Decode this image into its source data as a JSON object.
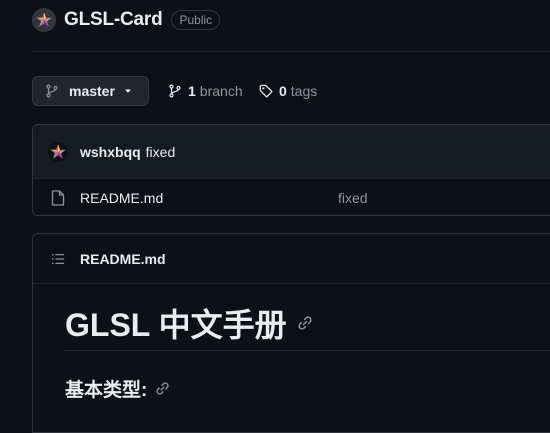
{
  "repo": {
    "name": "GLSL-Card",
    "visibility": "Public"
  },
  "branch_bar": {
    "current_branch": "master",
    "branches_count": "1",
    "branches_label": "branch",
    "tags_count": "0",
    "tags_label": "tags"
  },
  "latest_commit": {
    "author": "wshxbqq",
    "message": "fixed"
  },
  "files": [
    {
      "name": "README.md",
      "commit_message": "fixed",
      "icon": "file-icon"
    }
  ],
  "readme": {
    "file_label": "README.md",
    "h1": "GLSL 中文手册",
    "h3": "基本类型:"
  },
  "colors": {
    "background": "#0d1117",
    "border": "#30363d",
    "text": "#e6edf3",
    "muted": "#8b949e"
  }
}
